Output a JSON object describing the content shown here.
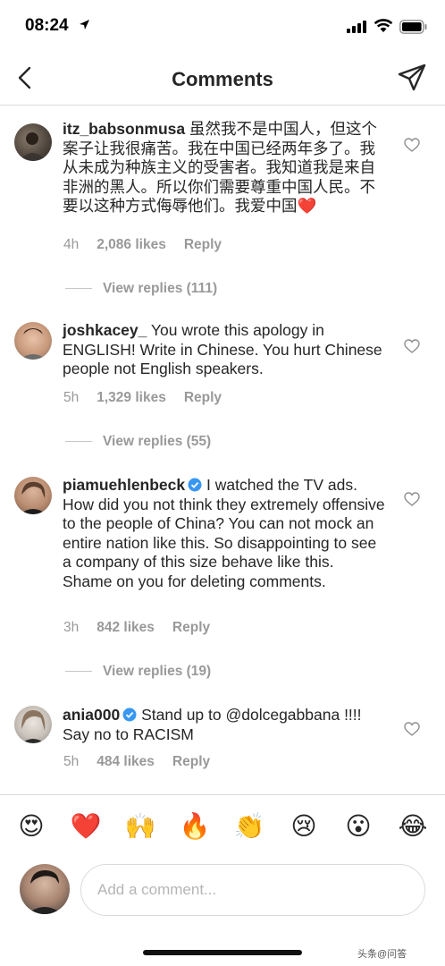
{
  "status_bar": {
    "time": "08:24"
  },
  "header": {
    "title": "Comments"
  },
  "comments": [
    {
      "username": "itz_babsonmusa",
      "text": "虽然我不是中国人，但这个案子让我很痛苦。我在中国已经两年多了。我从未成为种族主义的受害者。我知道我是来自非洲的黑人。所以你们需要尊重中国人民。不要以这种方式侮辱他们。我爱中国",
      "emoji": "❤️",
      "time": "4h",
      "likes": "2,086 likes",
      "reply": "Reply",
      "view_replies": "View replies (111)"
    },
    {
      "username": "joshkacey_",
      "text": "You wrote this apology in ENGLISH! Write in Chinese. You hurt Chinese people not English speakers.",
      "time": "5h",
      "likes": "1,329 likes",
      "reply": "Reply",
      "view_replies": "View replies (55)"
    },
    {
      "username": "piamuehlenbeck",
      "text": "I watched the TV ads. How did you not think they extremely offensive to the people of China? You can not mock an entire nation like this. So disappointing to see a company of this size behave like this. Shame on you for deleting comments.",
      "time": "3h",
      "likes": "842 likes",
      "reply": "Reply",
      "view_replies": "View replies (19)"
    },
    {
      "username": "ania000",
      "text": "Stand up to @dolcegabbana !!!! Say no to RACISM",
      "time": "5h",
      "likes": "484 likes",
      "reply": "Reply"
    }
  ],
  "emoji_bar": [
    "😍",
    "❤️",
    "🙌",
    "🔥",
    "👏",
    "😢",
    "😮",
    "😂"
  ],
  "composer": {
    "placeholder": "Add a comment..."
  },
  "watermark": "头条@问答"
}
